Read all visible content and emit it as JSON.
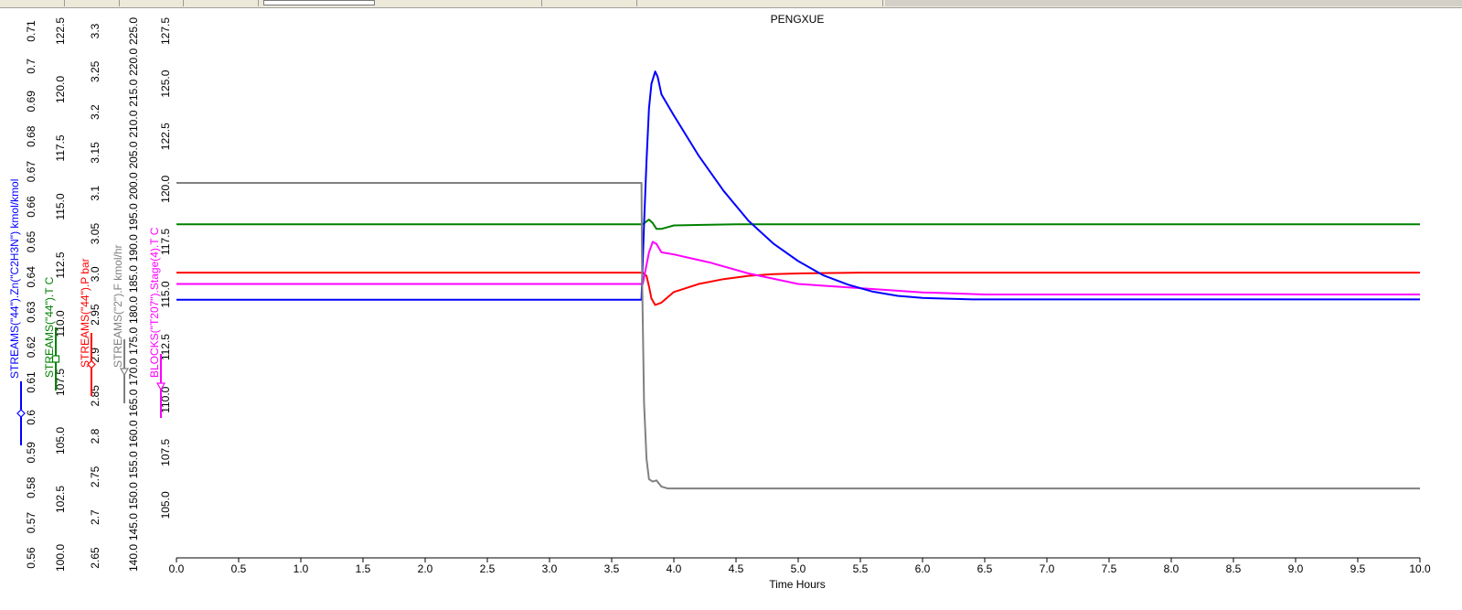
{
  "window": {
    "title": "PENGXUE",
    "xlabel": "Time Hours"
  },
  "colors": {
    "background": "#ffffff",
    "axis": "#000000"
  },
  "chart_data": {
    "type": "line",
    "title": "PENGXUE",
    "xlabel": "Time Hours",
    "xlim": [
      0,
      10
    ],
    "x_ticks": [
      "0.0",
      "0.5",
      "1.0",
      "1.5",
      "2.0",
      "2.5",
      "3.0",
      "3.5",
      "4.0",
      "4.5",
      "5.0",
      "5.5",
      "6.0",
      "6.5",
      "7.0",
      "7.5",
      "8.0",
      "8.5",
      "9.0",
      "9.5",
      "10.0"
    ],
    "grid": false,
    "legend": "vertical axis labels (left)",
    "axes": [
      {
        "label": "STREAMS(\"44\").Zn(\"C2H3N\") kmol/kmol",
        "color": "#0000ff",
        "marker": "diamond",
        "ylim": [
          0.56,
          0.71
        ],
        "ticks": [
          "0.56",
          "0.57",
          "0.58",
          "0.59",
          "0.6",
          "0.61",
          "0.62",
          "0.63",
          "0.64",
          "0.65",
          "0.66",
          "0.67",
          "0.68",
          "0.69",
          "0.7",
          "0.71"
        ]
      },
      {
        "label": "STREAMS(\"44\").T C",
        "color": "#008000",
        "marker": "square",
        "ylim": [
          100.0,
          122.5
        ],
        "ticks": [
          "100.0",
          "102.5",
          "105.0",
          "107.5",
          "110.0",
          "112.5",
          "115.0",
          "117.5",
          "120.0",
          "122.5"
        ]
      },
      {
        "label": "STREAMS(\"44\").P bar",
        "color": "#ff0000",
        "marker": "diamond",
        "ylim": [
          2.65,
          3.3
        ],
        "ticks": [
          "2.65",
          "2.7",
          "2.75",
          "2.8",
          "2.85",
          "2.9",
          "2.95",
          "3.0",
          "3.05",
          "3.1",
          "3.15",
          "3.2",
          "3.25",
          "3.3"
        ]
      },
      {
        "label": "STREAMS(\"2\").F kmol/hr",
        "color": "#808080",
        "marker": "triangle-down",
        "ylim": [
          140.0,
          225.0
        ],
        "ticks": [
          "140.0",
          "145.0",
          "150.0",
          "155.0",
          "160.0",
          "165.0",
          "170.0",
          "175.0",
          "180.0",
          "185.0",
          "190.0",
          "195.0",
          "200.0",
          "205.0",
          "210.0",
          "215.0",
          "220.0",
          "225.0"
        ]
      },
      {
        "label": "BLOCKS(\"T207\").Stage(4).T C",
        "color": "#ff00ff",
        "marker": "triangle-down",
        "ylim": [
          102.5,
          127.5
        ],
        "ticks": [
          "105.0",
          "107.5",
          "110.0",
          "112.5",
          "115.0",
          "117.5",
          "120.0",
          "122.5",
          "125.0",
          "127.5"
        ]
      }
    ],
    "series": [
      {
        "name": "STREAMS(\"44\").P bar",
        "axis": 2,
        "x": [
          0,
          3.75,
          3.78,
          3.8,
          3.82,
          3.85,
          3.9,
          4.0,
          4.2,
          4.4,
          4.6,
          4.8,
          5.0,
          5.5,
          6.0,
          10.0
        ],
        "y": [
          3.002,
          3.002,
          2.998,
          2.985,
          2.97,
          2.962,
          2.965,
          2.978,
          2.988,
          2.994,
          2.998,
          3.0,
          3.001,
          3.002,
          3.002,
          3.002
        ]
      },
      {
        "name": "BLOCKS(\"T207\").Stage(4).T C",
        "axis": 4,
        "x": [
          0,
          3.75,
          3.77,
          3.8,
          3.83,
          3.86,
          3.9,
          4.0,
          4.3,
          4.6,
          5.0,
          5.5,
          6.0,
          6.5,
          10.0
        ],
        "y": [
          115.5,
          115.5,
          116.1,
          117.0,
          117.5,
          117.4,
          117.0,
          116.9,
          116.5,
          116.0,
          115.5,
          115.3,
          115.1,
          115.0,
          115.0
        ]
      },
      {
        "name": "STREAMS(\"44\").T C",
        "axis": 1,
        "x": [
          0,
          3.75,
          3.8,
          3.83,
          3.86,
          3.9,
          4.0,
          4.5,
          10.0
        ],
        "y": [
          114.25,
          114.25,
          114.45,
          114.3,
          114.05,
          114.05,
          114.2,
          114.25,
          114.25
        ]
      },
      {
        "name": "STREAMS(\"44\").Zn(\"C2H3N\") kmol/kmol",
        "axis": 0,
        "x": [
          0,
          3.74,
          3.76,
          3.78,
          3.8,
          3.82,
          3.85,
          3.87,
          3.9,
          4.0,
          4.2,
          4.4,
          4.6,
          4.8,
          5.0,
          5.2,
          5.4,
          5.6,
          5.8,
          6.0,
          6.4,
          10.0
        ],
        "y": [
          0.6335,
          0.6335,
          0.655,
          0.673,
          0.688,
          0.695,
          0.6985,
          0.697,
          0.692,
          0.686,
          0.6745,
          0.6645,
          0.656,
          0.6495,
          0.6445,
          0.6405,
          0.6378,
          0.6358,
          0.6346,
          0.634,
          0.6336,
          0.6336
        ]
      },
      {
        "name": "STREAMS(\"2\").F kmol/hr",
        "axis": 3,
        "x": [
          0,
          3.74,
          3.745,
          3.76,
          3.78,
          3.8,
          3.83,
          3.86,
          3.9,
          3.95,
          10.0
        ],
        "y": [
          200.5,
          200.5,
          185.0,
          165.0,
          156.0,
          152.7,
          152.3,
          152.5,
          151.5,
          151.2,
          151.2
        ]
      }
    ]
  }
}
